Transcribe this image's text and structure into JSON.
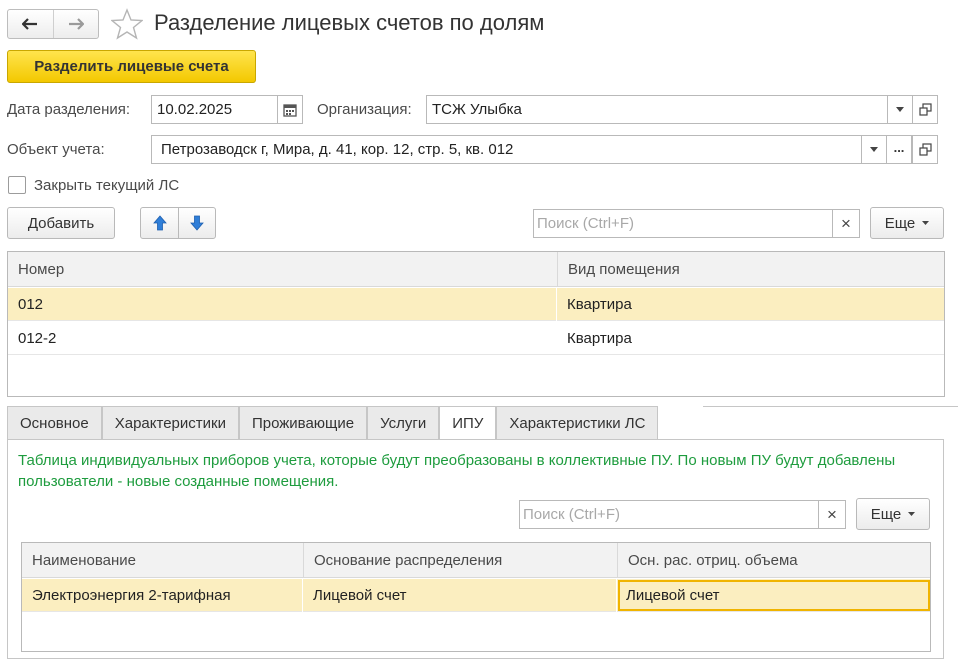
{
  "window": {
    "title": "Разделение лицевых счетов по долям"
  },
  "toolbar": {
    "split_button": "Разделить лицевые счета"
  },
  "form": {
    "date_label": "Дата разделения:",
    "date_value": "10.02.2025",
    "org_label": "Организация:",
    "org_value": "ТСЖ Улыбка",
    "object_label": "Объект учета:",
    "object_value": "Петрозаводск г, Мира, д. 41, кор. 12, стр. 5, кв. 012",
    "object_select_label": "...",
    "close_ls_label": "Закрыть текущий ЛС"
  },
  "accounts": {
    "add_button": "Добавить",
    "search_placeholder": "Поиск (Ctrl+F)",
    "more_button": "Еще",
    "columns": [
      "Номер",
      "Вид помещения"
    ],
    "rows": [
      {
        "number": "012",
        "type": "Квартира"
      },
      {
        "number": "012-2",
        "type": "Квартира"
      }
    ]
  },
  "tabs": [
    "Основное",
    "Характеристики",
    "Проживающие",
    "Услуги",
    "ИПУ",
    "Характеристики ЛС"
  ],
  "active_tab": "ИПУ",
  "ipu": {
    "info_text": "Таблица индивидуальных приборов учета, которые будут преобразованы в коллективные ПУ. По новым ПУ будут добавлены пользователи - новые созданные помещения.",
    "search_placeholder": "Поиск (Ctrl+F)",
    "more_button": "Еще",
    "columns": [
      "Наименование",
      "Основание распределения",
      "Осн. рас. отриц. объема"
    ],
    "rows": [
      {
        "name": "Электроэнергия 2-тарифная",
        "basis": "Лицевой счет",
        "neg_basis": "Лицевой счет"
      }
    ]
  },
  "colors": {
    "accent_yellow": "#f3c800",
    "selected_row": "#fbeec0",
    "info_green": "#1e9c3e",
    "arrow_blue": "#2f7ed8"
  }
}
